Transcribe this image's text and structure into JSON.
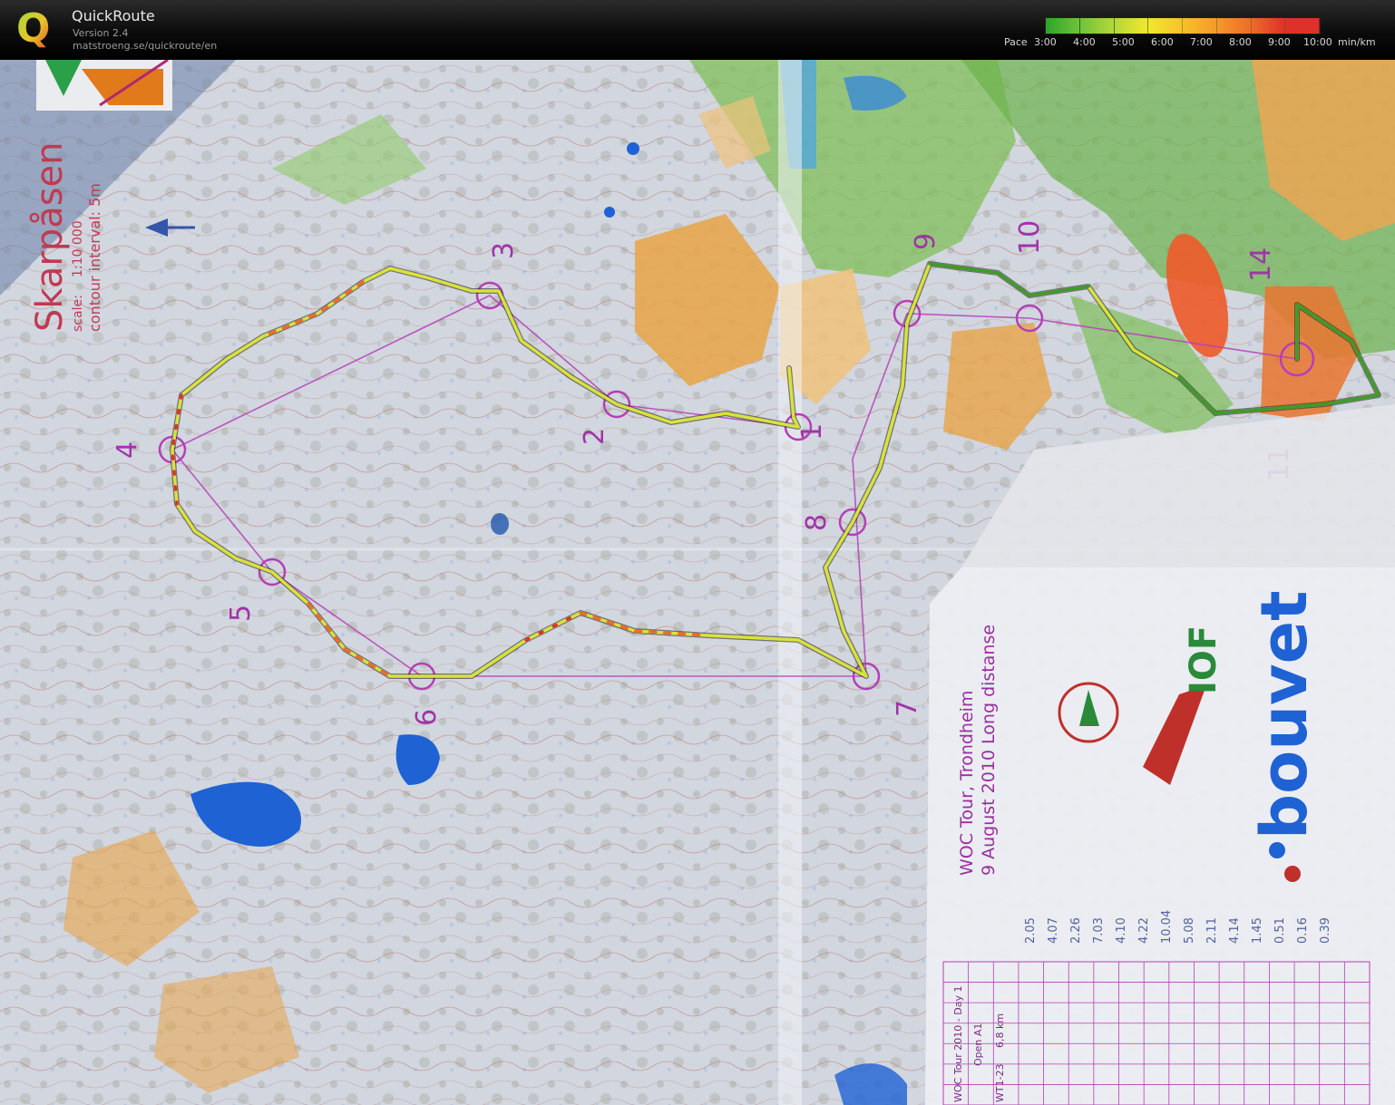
{
  "app": {
    "title": "QuickRoute",
    "version": "Version 2.4",
    "url": "matstroeng.se/quickroute/en",
    "logo_letter": "Q"
  },
  "pace_legend": {
    "label": "Pace",
    "ticks": [
      "3:00",
      "4:00",
      "5:00",
      "6:00",
      "7:00",
      "8:00",
      "9:00",
      "10:00"
    ],
    "unit": "min/km",
    "colors": [
      "#2fa329",
      "#6fc23c",
      "#b4d838",
      "#f2e82c",
      "#f7c12b",
      "#f49a2a",
      "#ee6b2a",
      "#e0302a"
    ]
  },
  "map": {
    "title": "Skarpåsen",
    "scale_label": "scale:",
    "scale_value": "1:10 000",
    "contour": "contour interval: 5m",
    "event_title": "WOC Tour, Trondheim",
    "event_date": "9 August 2010 Long distanse",
    "course_header": "WOC Tour 2010 - Day 1",
    "course_name": "Open A1",
    "course_length": "6,8 km",
    "course_code": "WT1-23",
    "sponsor": "bouvet",
    "iof_logo": "IOF",
    "control_numbers": [
      "1",
      "2",
      "3",
      "4",
      "5",
      "6",
      "7",
      "8",
      "9",
      "10",
      "11",
      "14"
    ],
    "split_times": [
      "2.05",
      "4.07",
      "2.26",
      "7.03",
      "4.10",
      "4.22",
      "10.04",
      "5.08",
      "2.11",
      "4.14",
      "1.45",
      "0.51",
      "0.16",
      "0.39"
    ],
    "colors": {
      "paper": "#dfe3ea",
      "open_land": "#e9a447",
      "rough_open": "#f0c27a",
      "green": "#7fbf5a",
      "water": "#1f62d4",
      "course": "#b53fb6",
      "contour": "#b6563f"
    }
  }
}
